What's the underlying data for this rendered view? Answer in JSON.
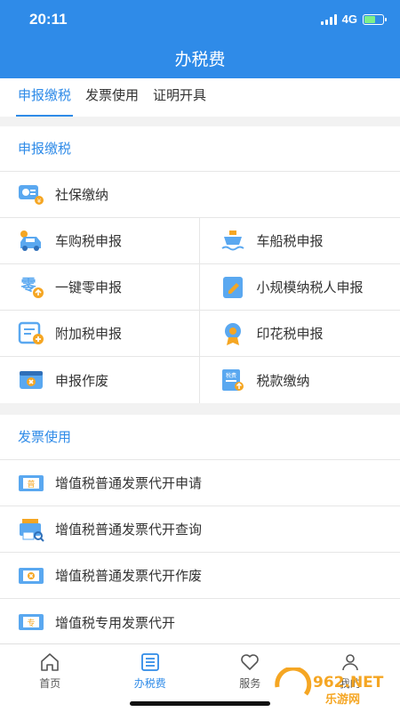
{
  "status": {
    "time": "20:11",
    "network": "4G"
  },
  "header": {
    "title": "办税费"
  },
  "tabs": [
    {
      "label": "申报缴税",
      "active": true
    },
    {
      "label": "发票使用",
      "active": false
    },
    {
      "label": "证明开具",
      "active": false
    }
  ],
  "sections": {
    "declare": {
      "title": "申报缴税",
      "items": [
        {
          "label": "社保缴纳",
          "icon": "social-security-card-icon"
        },
        {
          "label": "车购税申报",
          "icon": "car-icon"
        },
        {
          "label": "车船税申报",
          "icon": "ship-icon"
        },
        {
          "label": "一键零申报",
          "icon": "zero-declare-icon"
        },
        {
          "label": "小规模纳税人申报",
          "icon": "small-taxpayer-icon"
        },
        {
          "label": "附加税申报",
          "icon": "surtax-form-icon"
        },
        {
          "label": "印花税申报",
          "icon": "stamp-badge-icon"
        },
        {
          "label": "申报作废",
          "icon": "void-declaration-icon"
        },
        {
          "label": "税款缴纳",
          "icon": "tax-payment-icon"
        }
      ]
    },
    "invoice": {
      "title": "发票使用",
      "items": [
        {
          "label": "增值税普通发票代开申请",
          "icon": "invoice-apply-icon",
          "glyph": "普"
        },
        {
          "label": "增值税普通发票代开查询",
          "icon": "invoice-query-icon"
        },
        {
          "label": "增值税普通发票代开作废",
          "icon": "invoice-void-icon"
        },
        {
          "label": "增值税专用发票代开",
          "icon": "special-invoice-icon",
          "glyph": "专"
        }
      ]
    }
  },
  "bottom_nav": [
    {
      "label": "首页",
      "icon": "home-icon",
      "active": false
    },
    {
      "label": "办税费",
      "icon": "list-icon",
      "active": true
    },
    {
      "label": "服务",
      "icon": "heart-icon",
      "active": false
    },
    {
      "label": "我的",
      "icon": "user-icon",
      "active": false
    }
  ],
  "watermark": {
    "text_top": "962.NET",
    "text_bottom": "乐游网"
  },
  "colors": {
    "primary": "#2f8be8",
    "orange": "#f5a623",
    "icon_blue": "#5aa8f0"
  }
}
